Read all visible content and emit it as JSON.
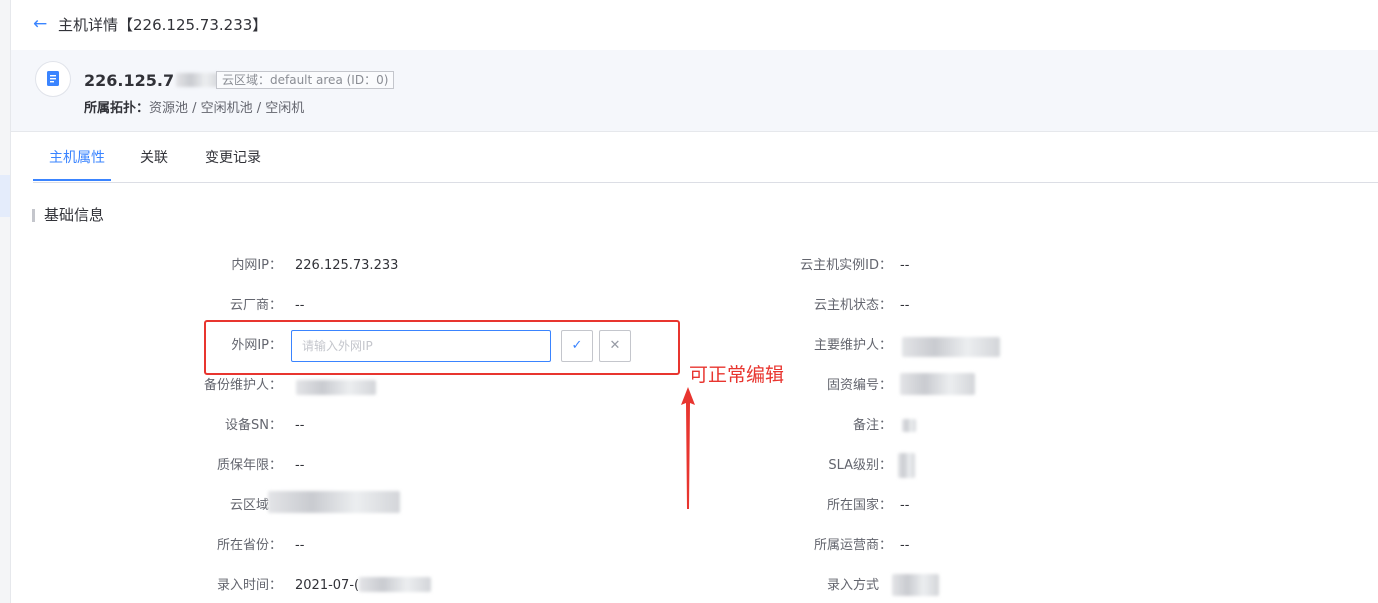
{
  "header": {
    "back_icon": "arrow-left-icon",
    "title": "主机详情【226.125.73.233】"
  },
  "host": {
    "ip": "226.125.7",
    "cloud_area_tag": "云区域：default area (ID：0)",
    "topology_label": "所属拓扑：",
    "topology_path": "资源池 / 空闲机池 / 空闲机"
  },
  "tabs": [
    {
      "label": "主机属性"
    },
    {
      "label": "关联"
    },
    {
      "label": "变更记录"
    }
  ],
  "section": {
    "title": "基础信息"
  },
  "left_fields": [
    {
      "label": "内网IP：",
      "value": "226.125.73.233"
    },
    {
      "label": "云厂商：",
      "value": "--"
    },
    {
      "label": "外网IP：",
      "value": ""
    },
    {
      "label": "备份维护人：",
      "value": ""
    },
    {
      "label": "设备SN：",
      "value": "--"
    },
    {
      "label": "质保年限：",
      "value": "--"
    },
    {
      "label": "云区域：",
      "value": ""
    },
    {
      "label": "所在省份：",
      "value": "--"
    },
    {
      "label": "录入时间：",
      "value": "2021-07-("
    }
  ],
  "right_fields": [
    {
      "label": "云主机实例ID：",
      "value": "--"
    },
    {
      "label": "云主机状态：",
      "value": "--"
    },
    {
      "label": "主要维护人：",
      "value": ""
    },
    {
      "label": "固资编号：",
      "value": ""
    },
    {
      "label": "备注：",
      "value": ""
    },
    {
      "label": "SLA级别：",
      "value": ""
    },
    {
      "label": "所在国家：",
      "value": "--"
    },
    {
      "label": "所属运营商：",
      "value": "--"
    },
    {
      "label": "录入方式",
      "value": ""
    }
  ],
  "edit": {
    "placeholder": "请输入外网IP",
    "confirm_icon": "check-icon",
    "cancel_icon": "close-icon"
  },
  "annotation": {
    "text": "可正常编辑",
    "color": "#e8352f"
  },
  "colors": {
    "accent": "#3a84ff",
    "annotation_red": "#e8352f"
  }
}
